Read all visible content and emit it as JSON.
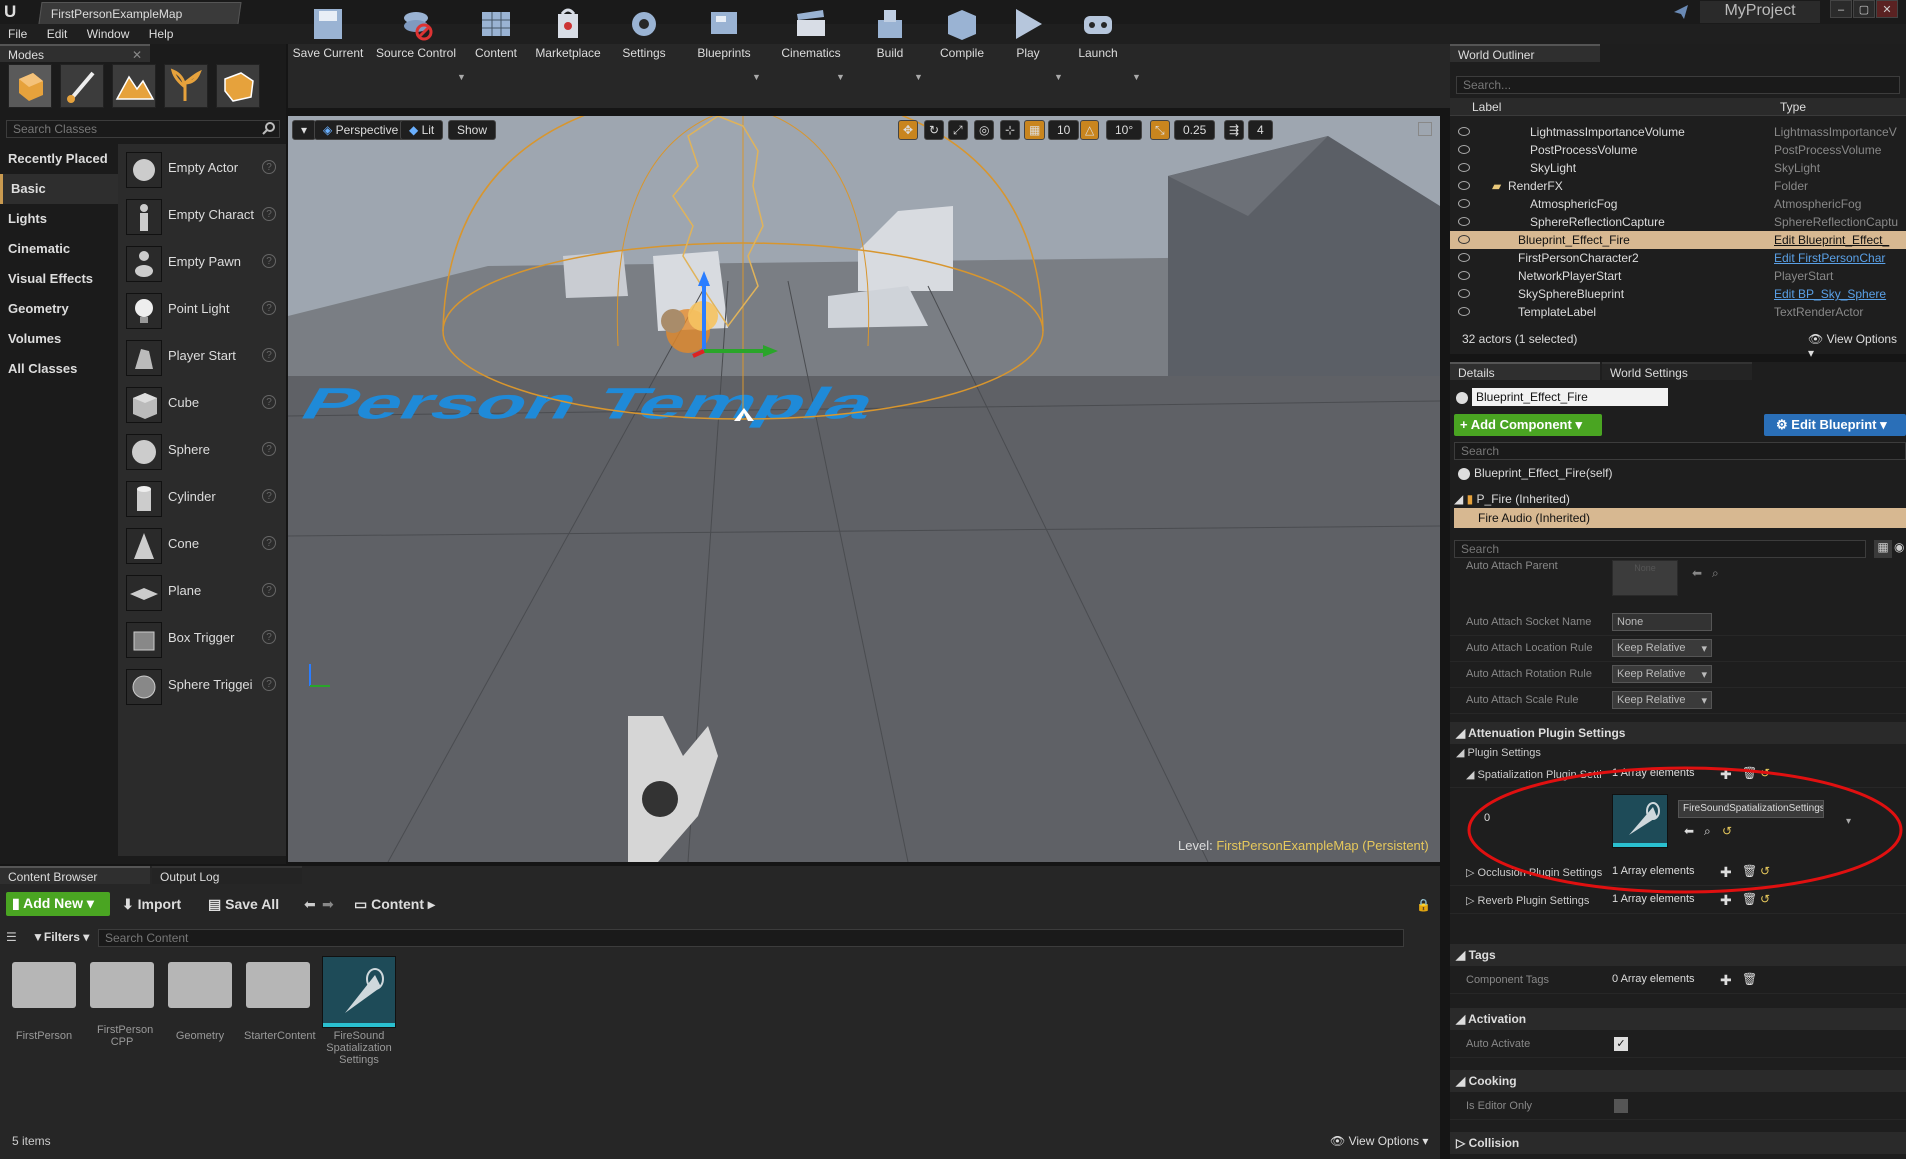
{
  "app": {
    "doc_tab": "FirstPersonExampleMap",
    "project": "MyProject"
  },
  "menu": [
    "File",
    "Edit",
    "Window",
    "Help"
  ],
  "modes": {
    "tab": "Modes",
    "search_placeholder": "Search Classes",
    "categories": [
      "Recently Placed",
      "Basic",
      "Lights",
      "Cinematic",
      "Visual Effects",
      "Geometry",
      "Volumes",
      "All Classes"
    ],
    "selected_category": "Basic",
    "items": [
      "Empty Actor",
      "Empty Charact",
      "Empty Pawn",
      "Point Light",
      "Player Start",
      "Cube",
      "Sphere",
      "Cylinder",
      "Cone",
      "Plane",
      "Box Trigger",
      "Sphere Triggei"
    ]
  },
  "toolbar": [
    "Save Current",
    "Source Control",
    "Content",
    "Marketplace",
    "Settings",
    "Blueprints",
    "Cinematics",
    "Build",
    "Compile",
    "Play",
    "Launch"
  ],
  "viewport": {
    "perspective": "Perspective",
    "lit": "Lit",
    "show": "Show",
    "grid": "10",
    "angle": "10°",
    "scale": "0.25",
    "speed": "4",
    "floor_text": "st Person Templa",
    "level_label": "Level:",
    "level_name": "FirstPersonExampleMap (Persistent)"
  },
  "outliner": {
    "tab": "World Outliner",
    "search_placeholder": "Search...",
    "col_label": "Label",
    "col_type": "Type",
    "rows": [
      {
        "label": "LightmassImportanceVolume",
        "type": "LightmassImportanceV"
      },
      {
        "label": "PostProcessVolume",
        "type": "PostProcessVolume"
      },
      {
        "label": "SkyLight",
        "type": "SkyLight"
      },
      {
        "label": "RenderFX",
        "type": "Folder"
      },
      {
        "label": "AtmosphericFog",
        "type": "AtmosphericFog"
      },
      {
        "label": "SphereReflectionCapture",
        "type": "SphereReflectionCaptu"
      },
      {
        "label": "Blueprint_Effect_Fire",
        "type": "Edit Blueprint_Effect_"
      },
      {
        "label": "FirstPersonCharacter2",
        "type": "Edit FirstPersonChar"
      },
      {
        "label": "NetworkPlayerStart",
        "type": "PlayerStart"
      },
      {
        "label": "SkySphereBlueprint",
        "type": "Edit BP_Sky_Sphere"
      },
      {
        "label": "TemplateLabel",
        "type": "TextRenderActor"
      }
    ],
    "status": "32 actors (1 selected)",
    "view_options": "View Options"
  },
  "details": {
    "tab": "Details",
    "tab2": "World Settings",
    "actor_name": "Blueprint_Effect_Fire",
    "add_component": "+ Add Component",
    "edit_blueprint": "Edit Blueprint",
    "search_placeholder": "Search",
    "self_row": "Blueprint_Effect_Fire(self)",
    "comp1": "P_Fire (Inherited)",
    "comp2": "Fire Audio (Inherited)",
    "search2_placeholder": "Search",
    "auto_attach_parent": "Auto Attach Parent",
    "none_thumb": "None",
    "socket_name": "Auto Attach Socket Name",
    "socket_val": "None",
    "loc_rule": "Auto Attach Location Rule",
    "rot_rule": "Auto Attach Rotation Rule",
    "scale_rule": "Auto Attach Scale Rule",
    "keep_relative": "Keep Relative",
    "atten_section": "Attenuation Plugin Settings",
    "plugin_settings": "Plugin Settings",
    "spatial": "Spatialization Plugin Setti",
    "array1": "1 Array elements",
    "index0": "0",
    "asset_name": "FireSoundSpatializationSettings",
    "occlusion": "Occlusion Plugin Settings",
    "reverb": "Reverb Plugin Settings",
    "tags_section": "Tags",
    "component_tags": "Component Tags",
    "array0": "0 Array elements",
    "activation_section": "Activation",
    "auto_activate": "Auto Activate",
    "cooking_section": "Cooking",
    "editor_only": "Is Editor Only",
    "collision_section": "Collision"
  },
  "content_browser": {
    "tab": "Content Browser",
    "tab2": "Output Log",
    "add_new": "Add New",
    "import": "Import",
    "save_all": "Save All",
    "path": "Content",
    "filters": "Filters",
    "search_placeholder": "Search Content",
    "folders": [
      "FirstPerson",
      "FirstPerson CPP",
      "Geometry",
      "StarterContent"
    ],
    "asset": "FireSound Spatialization Settings",
    "item_count": "5 items",
    "view_options": "View Options"
  },
  "colors": {
    "accent_green": "#4aa522",
    "accent_blue": "#2a6fb8",
    "selection": "#d7b891",
    "annotation": "#e01010"
  }
}
